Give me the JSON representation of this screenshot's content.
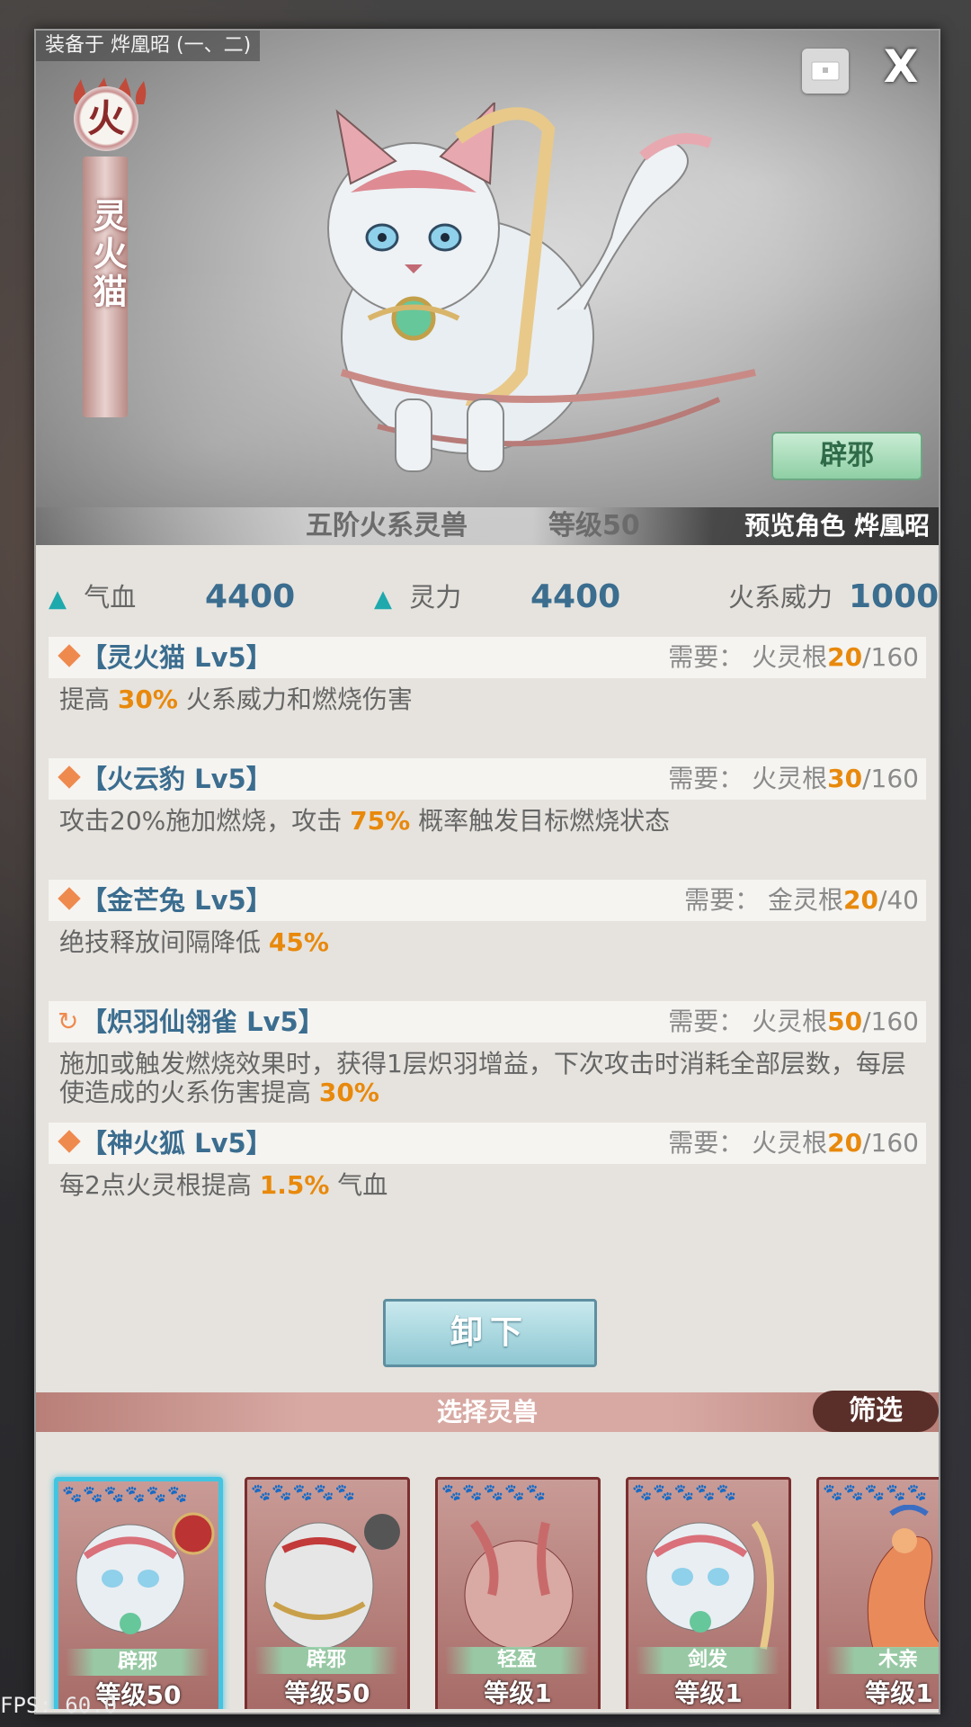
{
  "header": {
    "equipped_on": "装备于 烨凰昭 (一、二)",
    "close_label": "X",
    "element_badge": "火",
    "beast_name": "灵火猫",
    "trait_label": "辟邪",
    "grade_text": "五阶火系灵兽",
    "level_text": "等级50",
    "preview_text": "预览角色 烨凰昭"
  },
  "stats": {
    "hp_label": "气血",
    "hp_value": "4400",
    "sp_label": "灵力",
    "sp_value": "4400",
    "fire_label": "火系威力",
    "fire_value": "1000"
  },
  "skills": [
    {
      "name": "【灵火猫 Lv5】",
      "req_prefix": "需要：  火灵根",
      "req_cur": "20",
      "req_max": "/160",
      "desc_pre": "提高 ",
      "desc_hl": "30%",
      "desc_post": " 火系威力和燃烧伤害"
    },
    {
      "name": "【火云豹 Lv5】",
      "req_prefix": "需要：  火灵根",
      "req_cur": "30",
      "req_max": "/160",
      "desc_pre": "攻击20%施加燃烧，攻击 ",
      "desc_hl": "75%",
      "desc_post": " 概率触发目标燃烧状态"
    },
    {
      "name": "【金芒兔 Lv5】",
      "req_prefix": "需要：  金灵根",
      "req_cur": "20",
      "req_max": "/40",
      "desc_pre": "绝技释放间隔降低 ",
      "desc_hl": "45%",
      "desc_post": ""
    },
    {
      "name": "【炽羽仙翎雀 Lv5】",
      "req_prefix": "需要：  火灵根",
      "req_cur": "50",
      "req_max": "/160",
      "desc_pre": "施加或触发燃烧效果时，获得1层炽羽增益，下次攻击时消耗全部层数，每层使造成的火系伤害提高 ",
      "desc_hl": "30%",
      "desc_post": ""
    },
    {
      "name": "【神火狐 Lv5】",
      "req_prefix": "需要：  火灵根",
      "req_cur": "20",
      "req_max": "/160",
      "desc_pre": "每2点火灵根提高 ",
      "desc_hl": "1.5%",
      "desc_post": " 气血"
    }
  ],
  "unequip_label": "卸下",
  "select_title": "选择灵兽",
  "filter_label": "筛选",
  "cards": [
    {
      "tag": "辟邪",
      "level": "等级50",
      "stars": "🐾🐾🐾🐾🐾🐾"
    },
    {
      "tag": "辟邪",
      "level": "等级50",
      "stars": "🐾🐾🐾🐾🐾"
    },
    {
      "tag": "轻盈",
      "level": "等级1",
      "stars": "🐾🐾🐾🐾🐾"
    },
    {
      "tag": "剑发",
      "level": "等级1",
      "stars": "🐾🐾🐾🐾🐾"
    },
    {
      "tag": "木亲",
      "level": "等级1",
      "stars": "🐾🐾🐾🐾🐾"
    }
  ],
  "fps": "FPS: 60.0"
}
